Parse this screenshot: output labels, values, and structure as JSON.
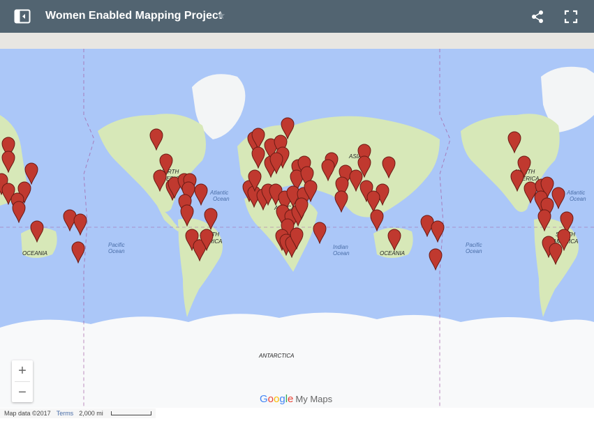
{
  "header": {
    "title": "Women Enabled Mapping Project",
    "star_glyph": "★",
    "sidebar_icon": "sidebar-toggle-icon",
    "share_icon": "share-icon",
    "fullscreen_icon": "fullscreen-icon",
    "background": "#526471"
  },
  "map": {
    "ocean_color": "#abc7f8",
    "land_color": "#d7e8b8",
    "ice_color": "#f8f9fa",
    "pin_color": "#c0392f",
    "labels": [
      {
        "text": "NORTH",
        "kind": "cont"
      },
      {
        "text": "AMERICA",
        "kind": "cont"
      },
      {
        "text": "Atlantic",
        "kind": "ocean"
      },
      {
        "text": "Ocean",
        "kind": "ocean"
      },
      {
        "text": "SOUTH",
        "kind": "cont"
      },
      {
        "text": "AMERICA",
        "kind": "cont"
      },
      {
        "text": "Pacific",
        "kind": "ocean"
      },
      {
        "text": "Ocean",
        "kind": "ocean"
      },
      {
        "text": "OCEANIA",
        "kind": "cont"
      },
      {
        "text": "ASIA",
        "kind": "cont"
      },
      {
        "text": "AFRICA",
        "kind": "cont"
      },
      {
        "text": "Indian",
        "kind": "ocean"
      },
      {
        "text": "Ocean",
        "kind": "ocean"
      },
      {
        "text": "OCEANIA",
        "kind": "cont"
      },
      {
        "text": "NORTH",
        "kind": "cont"
      },
      {
        "text": "AMERICA",
        "kind": "cont"
      },
      {
        "text": "Atlantic",
        "kind": "ocean"
      },
      {
        "text": "Ocean",
        "kind": "ocean"
      },
      {
        "text": "Pacific",
        "kind": "ocean"
      },
      {
        "text": "Ocean",
        "kind": "ocean"
      },
      {
        "text": "SOUTH",
        "kind": "cont"
      },
      {
        "text": "AMERICA",
        "kind": "cont"
      },
      {
        "text": "ANTARCTICA",
        "kind": "cont"
      }
    ]
  },
  "controls": {
    "zoom_in": "+",
    "zoom_out": "−"
  },
  "branding": {
    "google": [
      "G",
      "o",
      "o",
      "g",
      "l",
      "e"
    ],
    "product": "My Maps"
  },
  "attribution": {
    "map_data": "Map data ©2017",
    "terms": "Terms",
    "scale": "2,000 mi"
  }
}
